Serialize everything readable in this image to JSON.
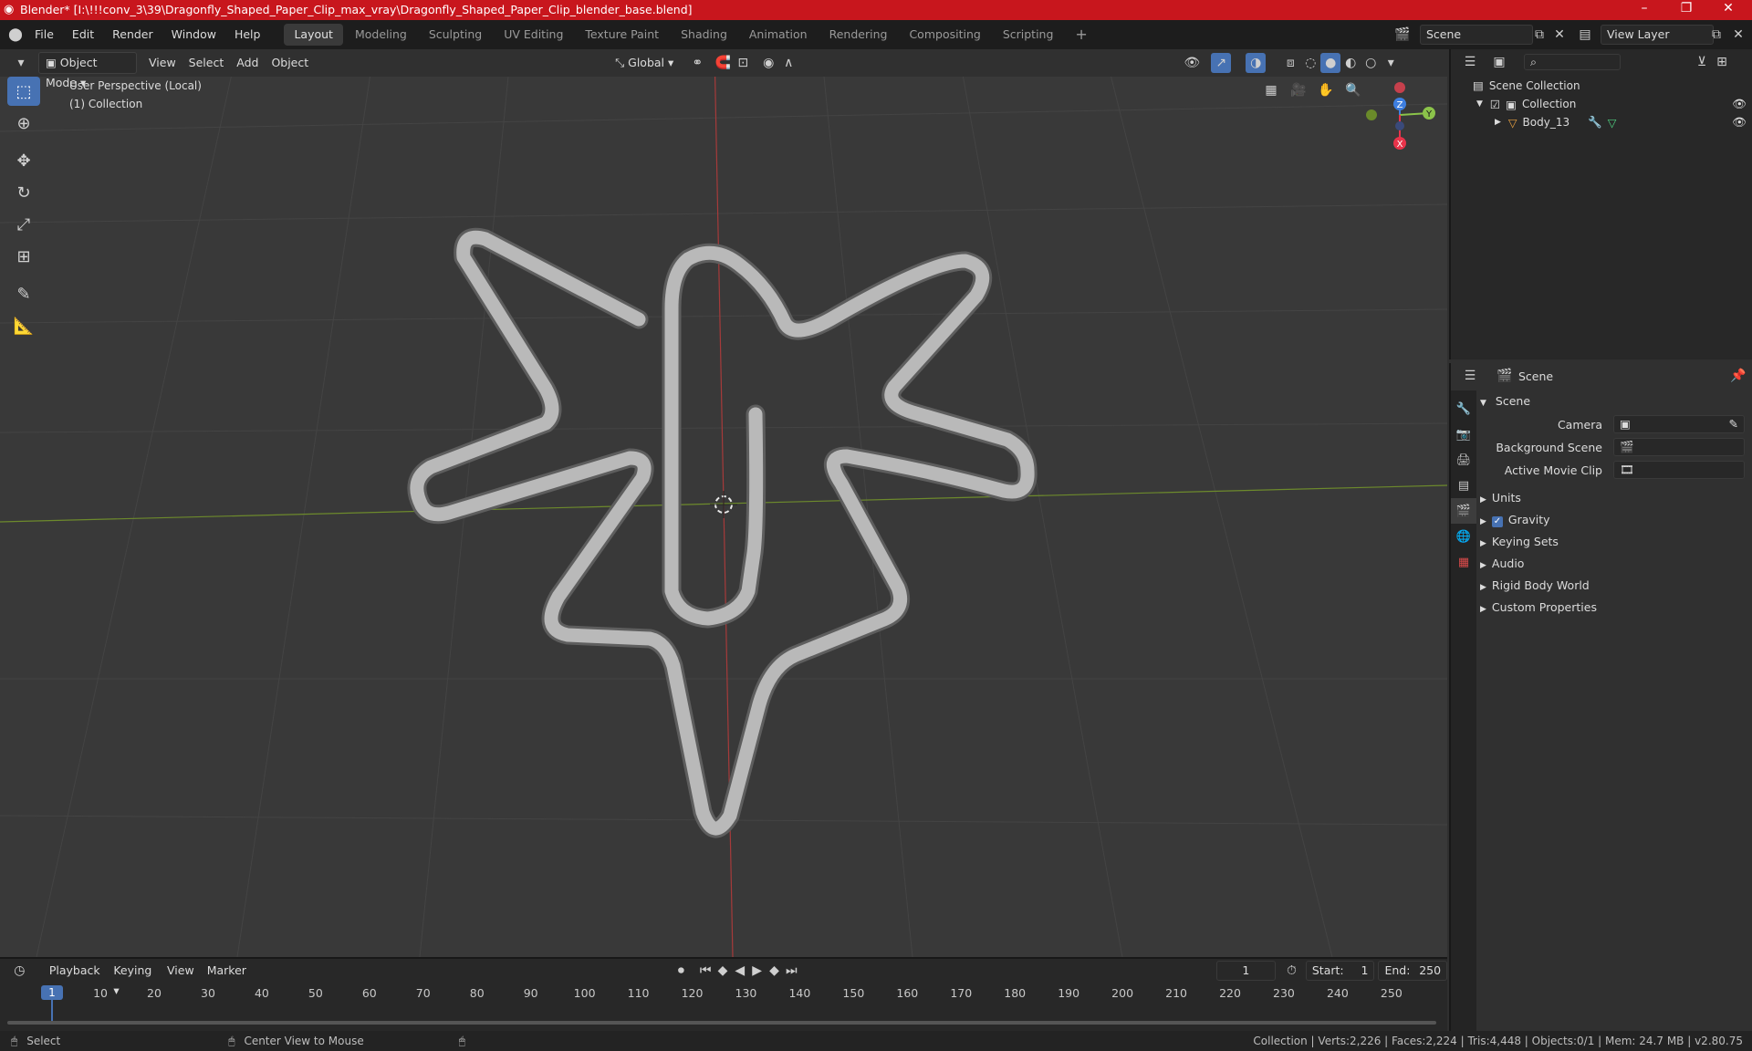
{
  "title_bar": {
    "title": "Blender* [I:\\!!!conv_3\\39\\Dragonfly_Shaped_Paper_Clip_max_vray\\Dragonfly_Shaped_Paper_Clip_blender_base.blend]",
    "minimize": "–",
    "maximize": "❐",
    "close": "✕"
  },
  "menu": [
    "File",
    "Edit",
    "Render",
    "Window",
    "Help"
  ],
  "workspaces": [
    "Layout",
    "Modeling",
    "Sculpting",
    "UV Editing",
    "Texture Paint",
    "Shading",
    "Animation",
    "Rendering",
    "Compositing",
    "Scripting"
  ],
  "active_workspace": "Layout",
  "scene_field": "Scene",
  "view_layer_field": "View Layer",
  "viewport_header": {
    "mode": "Object Mode",
    "menus": [
      "View",
      "Select",
      "Add",
      "Object"
    ],
    "orientation": "Global"
  },
  "viewport": {
    "perspective": "User Perspective (Local)",
    "collection": "(1) Collection",
    "axis_x": "X",
    "axis_y": "Y",
    "axis_z": "Z"
  },
  "outliner": {
    "root": "Scene Collection",
    "items": [
      {
        "label": "Collection"
      },
      {
        "label": "Body_13"
      }
    ]
  },
  "properties": {
    "header": "Scene",
    "panel_title": "Scene",
    "fields": [
      {
        "label": "Camera",
        "value": ""
      },
      {
        "label": "Background Scene",
        "value": ""
      },
      {
        "label": "Active Movie Clip",
        "value": ""
      }
    ],
    "sections": [
      "Units",
      "Gravity",
      "Keying Sets",
      "Audio",
      "Rigid Body World",
      "Custom Properties"
    ],
    "gravity_checked": true
  },
  "timeline": {
    "menus": [
      "Playback",
      "Keying",
      "View",
      "Marker"
    ],
    "current_frame": "1",
    "start_label": "Start:",
    "start": "1",
    "end_label": "End:",
    "end": "250",
    "ticks": [
      "1",
      "10",
      "20",
      "30",
      "40",
      "50",
      "60",
      "70",
      "80",
      "90",
      "100",
      "110",
      "120",
      "130",
      "140",
      "150",
      "160",
      "170",
      "180",
      "190",
      "200",
      "210",
      "220",
      "230",
      "240",
      "250"
    ]
  },
  "status_bar": {
    "select": "Select",
    "center": "Center View to Mouse",
    "stats": "Collection | Verts:2,226 | Faces:2,224 | Tris:4,448 | Objects:0/1 | Mem: 24.7 MB | v2.80.75"
  },
  "colors": {
    "title_bar": "#c8161d",
    "accent": "#4772b3",
    "x_axis": "#e8334a",
    "y_axis": "#8bc34a",
    "z_axis": "#3d7ee0"
  }
}
